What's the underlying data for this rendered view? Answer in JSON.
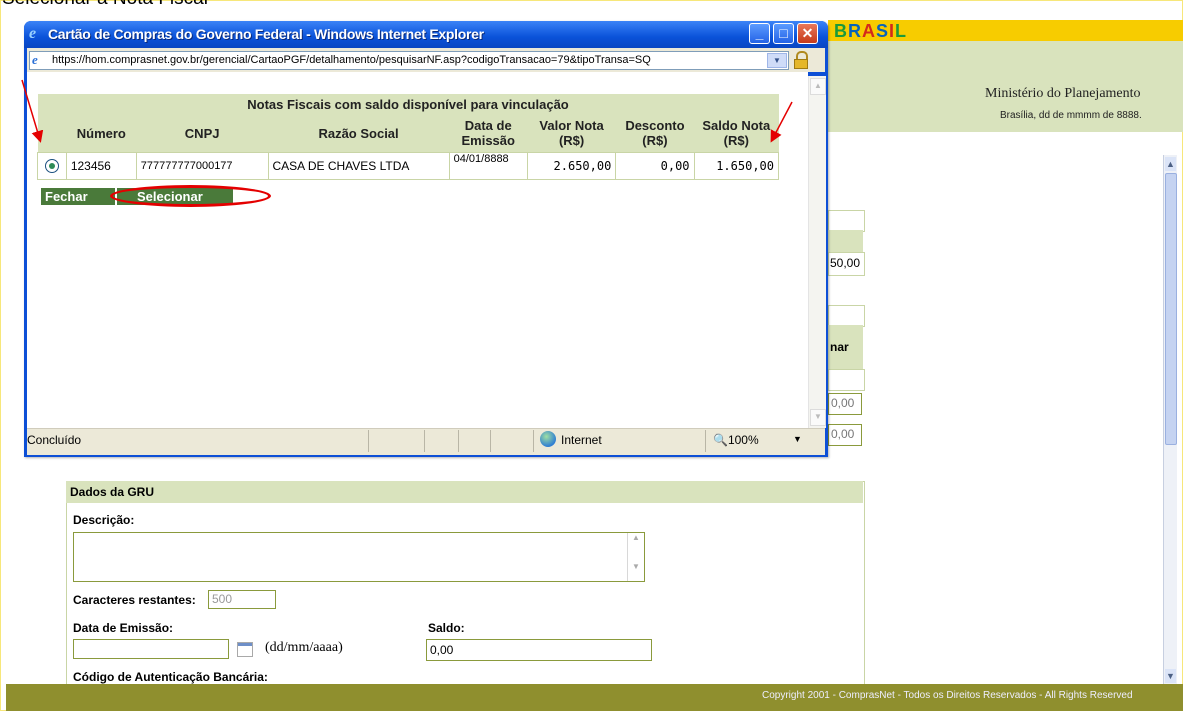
{
  "caption": "Selecionar a Nota Fiscal",
  "background": {
    "logo": {
      "part1": "B",
      "part2": "R",
      "part3": "A",
      "part4": "S",
      "part5": "I",
      "part6": "L"
    },
    "ministry": "Ministério do Planejamento",
    "date_line": "Brasília, dd de mmmm de 8888.",
    "fragment_value1": "50,00",
    "fragment_col": "nar",
    "fragment_value2": "0,00",
    "fragment_value3": "0,00",
    "footer": "Copyright 2001 - ComprasNet - Todos os Direitos Reservados - All Rights Reserved"
  },
  "gru": {
    "title": "Dados da GRU",
    "description_label": "Descrição:",
    "description_value": "",
    "remaining_label": "Caracteres restantes:",
    "remaining_value": "500",
    "date_label": "Data de Emissão:",
    "date_value": "",
    "date_format": "(dd/mm/aaaa)",
    "saldo_label": "Saldo:",
    "saldo_value": "0,00",
    "auth_label": "Código de Autenticação Bancária:"
  },
  "popup": {
    "title": "Cartão de Compras do Governo Federal - Windows Internet Explorer",
    "url": "https://hom.comprasnet.gov.br/gerencial/CartaoPGF/detalhamento/pesquisarNF.asp?codigoTransacao=79&tipoTransa=SQ",
    "status": "Concluído",
    "zone": "Internet",
    "zoom": "100%",
    "table": {
      "caption": "Notas Fiscais com saldo disponível para vinculação",
      "headers": [
        "",
        "Número",
        "CNPJ",
        "Razão Social",
        "Data de Emissão",
        "Valor Nota (R$)",
        "Desconto (R$)",
        "Saldo Nota (R$)"
      ],
      "header_lines": {
        "data1": "Data de",
        "data2": "Emissão",
        "valor1": "Valor Nota",
        "valor2": "(R$)",
        "desc1": "Desconto",
        "desc2": "(R$)",
        "saldo1": "Saldo Nota",
        "saldo2": "(R$)"
      },
      "rows": [
        {
          "numero": "123456",
          "cnpj": "777777777000177",
          "razao": "CASA DE CHAVES LTDA",
          "data": "04/01/8888",
          "valor": "2.650,00",
          "desconto": "0,00",
          "saldo": "1.650,00"
        }
      ]
    },
    "buttons": {
      "close": "Fechar",
      "select": "Selecionar"
    }
  },
  "colors": {
    "annotation": "#e40000",
    "header_green": "#d9e3bd",
    "button_green": "#4a7a3a",
    "footer": "#8f8f2e",
    "title_blue": "#0a52d9"
  }
}
